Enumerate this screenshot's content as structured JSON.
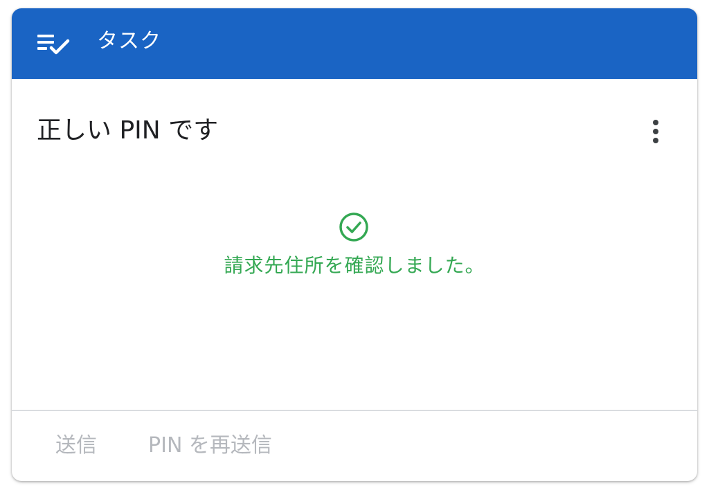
{
  "header": {
    "title": "タスク",
    "icon": "task-list-check-icon"
  },
  "card": {
    "title": "正しい PIN です",
    "menu_icon": "more-vert-icon"
  },
  "status": {
    "icon": "check-circle-icon",
    "message": "請求先住所を確認しました。",
    "color": "#34a853"
  },
  "actions": {
    "submit_label": "送信",
    "resend_label": "PIN を再送信"
  },
  "colors": {
    "header_bg": "#1a64c4",
    "disabled_text": "#b5b8bd"
  }
}
